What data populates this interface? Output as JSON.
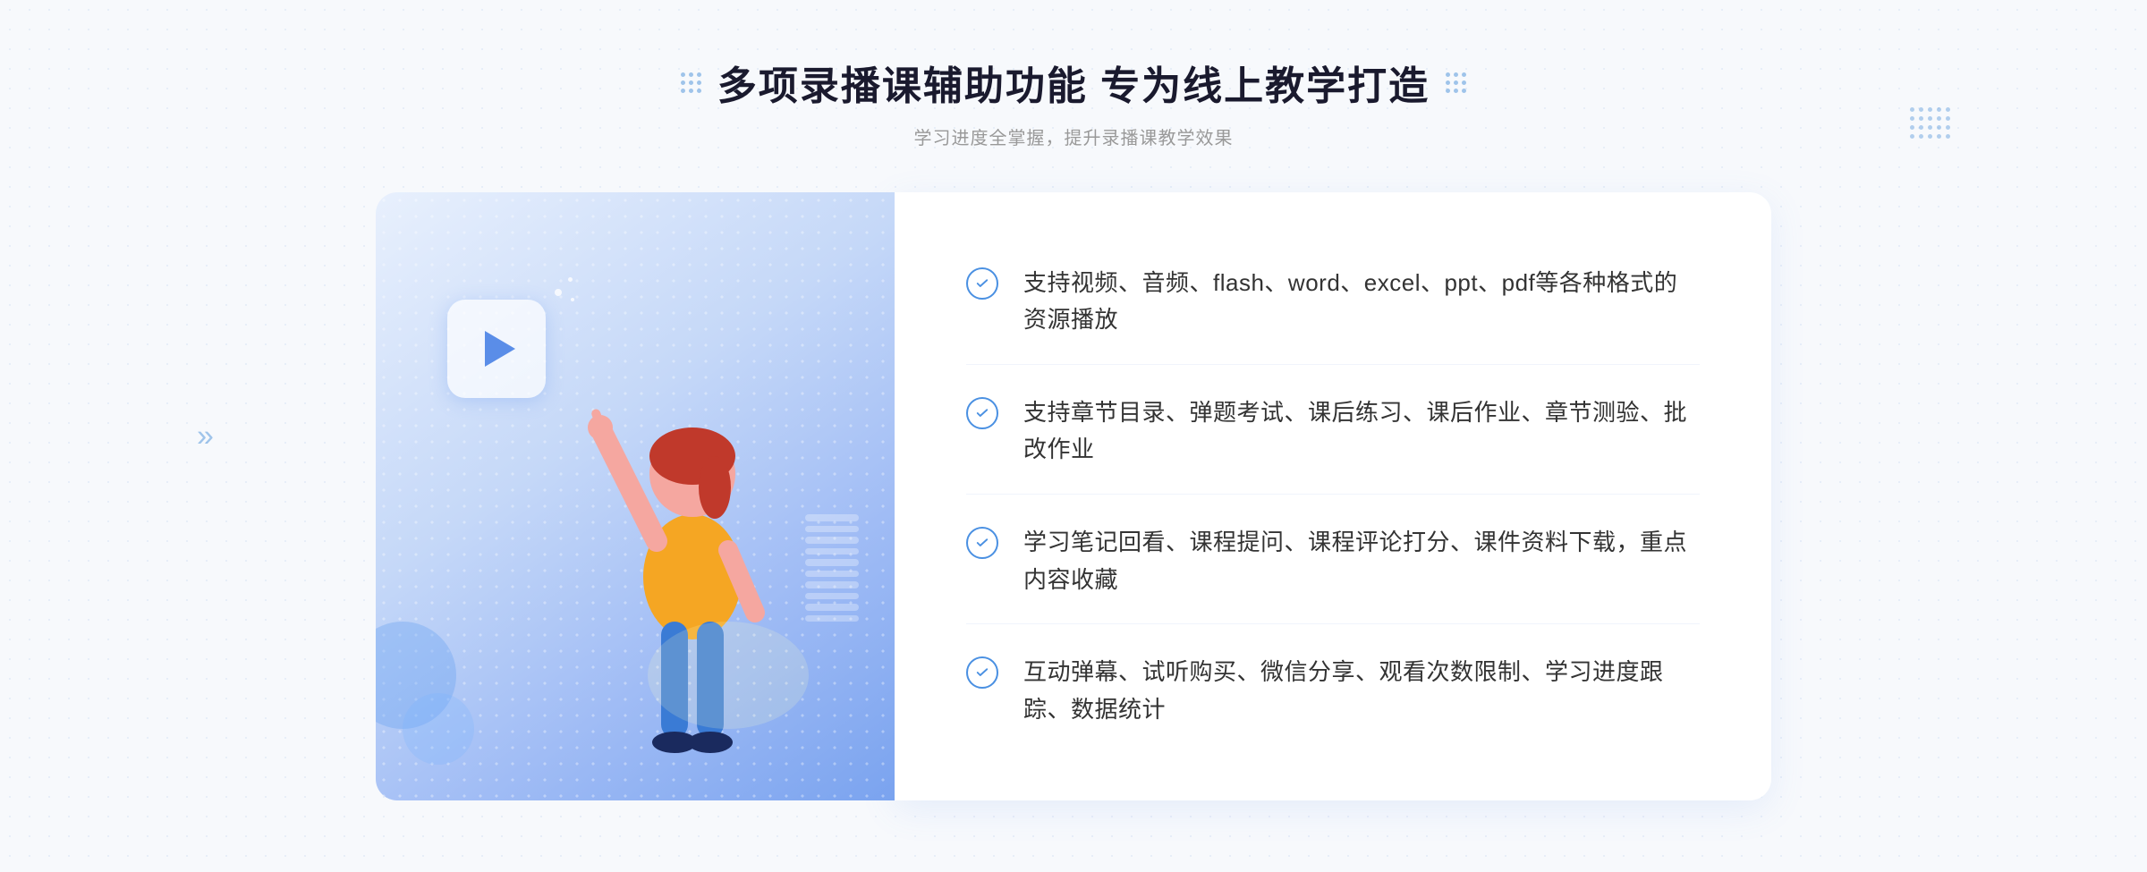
{
  "header": {
    "title": "多项录播课辅助功能 专为线上教学打造",
    "subtitle": "学习进度全掌握，提升录播课教学效果",
    "dots_left": true,
    "dots_right": true
  },
  "features": [
    {
      "id": "feature-1",
      "text": "支持视频、音频、flash、word、excel、ppt、pdf等各种格式的资源播放"
    },
    {
      "id": "feature-2",
      "text": "支持章节目录、弹题考试、课后练习、课后作业、章节测验、批改作业"
    },
    {
      "id": "feature-3",
      "text": "学习笔记回看、课程提问、课程评论打分、课件资料下载，重点内容收藏"
    },
    {
      "id": "feature-4",
      "text": "互动弹幕、试听购买、微信分享、观看次数限制、学习进度跟踪、数据统计"
    }
  ],
  "colors": {
    "primary_blue": "#4a90e2",
    "title_color": "#1a1a2e",
    "text_color": "#333333",
    "subtitle_color": "#999999"
  },
  "icons": {
    "check": "check-circle-icon",
    "play": "play-icon",
    "left_arrow": "left-chevron-icon",
    "right_dots": "decorative-dots-icon"
  }
}
